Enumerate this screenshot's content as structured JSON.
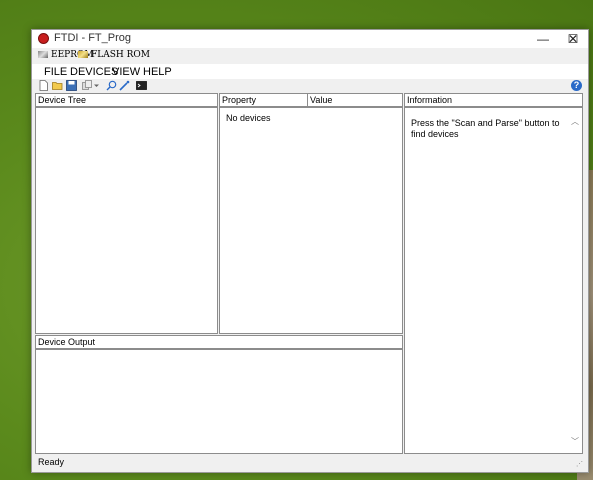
{
  "window": {
    "title": "FTDI - FT_Prog"
  },
  "window_controls": {
    "minimize": "—",
    "maximize": "☐",
    "close": "✕"
  },
  "tabs": [
    {
      "label": "EEPROM"
    },
    {
      "label": "FLASH ROM"
    }
  ],
  "menu": [
    {
      "label": "FILE"
    },
    {
      "label": "DEVICES"
    },
    {
      "label": "VIEW"
    },
    {
      "label": "HELP"
    }
  ],
  "toolbar": {
    "icons": [
      "new-file-icon",
      "open-folder-icon",
      "save-icon",
      "copy-icon",
      "dropdown-arrow-icon",
      "search-icon",
      "program-wand-icon",
      "console-icon"
    ],
    "help_label": "?"
  },
  "panels": {
    "device_tree": {
      "header": "Device Tree"
    },
    "properties": {
      "property_header": "Property",
      "value_header": "Value",
      "empty_text": "No devices"
    },
    "information": {
      "header": "Information",
      "text": "Press the \"Scan and Parse\" button to find devices"
    },
    "device_output": {
      "header": "Device Output"
    }
  },
  "status": {
    "text": "Ready"
  },
  "colors": {
    "accent": "#2a6ac8",
    "app_icon": "#c81e1e"
  }
}
